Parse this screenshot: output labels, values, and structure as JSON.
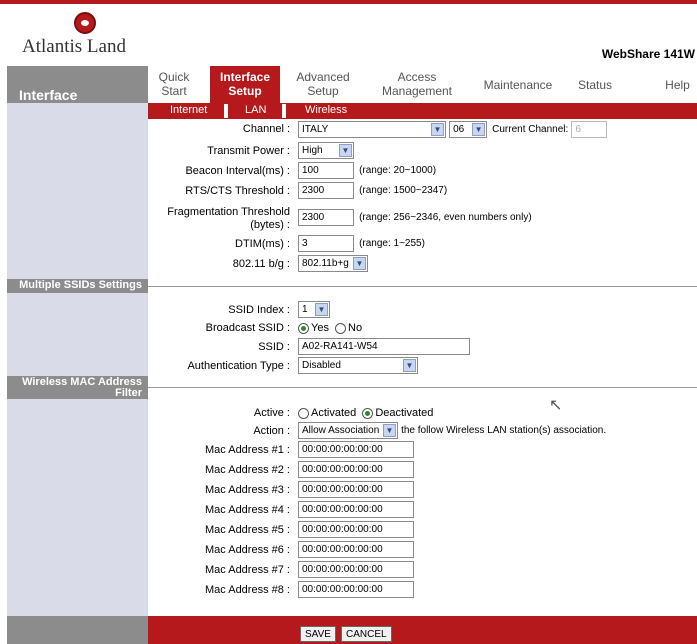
{
  "brand": {
    "logo_text": "Atlantis Land",
    "model": "WebShare 141W"
  },
  "sidebar": {
    "title": "Interface"
  },
  "menu": [
    {
      "label": "Quick\nStart"
    },
    {
      "label": "Interface\nSetup"
    },
    {
      "label": "Advanced\nSetup"
    },
    {
      "label": "Access\nManagement"
    },
    {
      "label": "Maintenance"
    },
    {
      "label": "Status"
    },
    {
      "label": "Help"
    }
  ],
  "submenu": [
    {
      "label": "Internet"
    },
    {
      "label": "LAN"
    },
    {
      "label": "Wireless"
    }
  ],
  "wireless": {
    "channel_label": "Channel :",
    "channel_country": "ITALY",
    "channel_number": "06",
    "current_channel_label": "Current Channel:",
    "current_channel_value": "6",
    "tx_power_label": "Transmit Power :",
    "tx_power_value": "High",
    "beacon_label": "Beacon Interval(ms) :",
    "beacon_value": "100",
    "beacon_hint": "(range: 20~1000)",
    "rts_label": "RTS/CTS Threshold :",
    "rts_value": "2300",
    "rts_hint": "(range: 1500~2347)",
    "frag_label_1": "Fragmentation Threshold",
    "frag_label_2": "(bytes)",
    "frag_value": "2300",
    "frag_hint": "(range: 256~2346, even numbers only)",
    "dtim_label": "DTIM(ms) :",
    "dtim_value": "3",
    "dtim_hint": "(range: 1~255)",
    "mode_label": "802.11 b/g :",
    "mode_value": "802.11b+g"
  },
  "ssid": {
    "section_title": "Multiple SSIDs Settings",
    "index_label": "SSID Index :",
    "index_value": "1",
    "broadcast_label": "Broadcast SSID :",
    "yes_label": "Yes",
    "no_label": "No",
    "ssid_label": "SSID :",
    "ssid_value": "A02-RA141-W54",
    "auth_label": "Authentication Type :",
    "auth_value": "Disabled"
  },
  "mac_filter": {
    "section_title_1": "Wireless MAC Address",
    "section_title_2": "Filter",
    "active_label": "Active :",
    "activated_label": "Activated",
    "deactivated_label": "Deactivated",
    "action_label": "Action :",
    "action_value": "Allow Association",
    "action_suffix": "the follow Wireless LAN station(s) association.",
    "addresses": [
      {
        "label": "Mac Address #1 :",
        "value": "00:00:00:00:00:00"
      },
      {
        "label": "Mac Address #2 :",
        "value": "00:00:00:00:00:00"
      },
      {
        "label": "Mac Address #3 :",
        "value": "00:00:00:00:00:00"
      },
      {
        "label": "Mac Address #4 :",
        "value": "00:00:00:00:00:00"
      },
      {
        "label": "Mac Address #5 :",
        "value": "00:00:00:00:00:00"
      },
      {
        "label": "Mac Address #6 :",
        "value": "00:00:00:00:00:00"
      },
      {
        "label": "Mac Address #7 :",
        "value": "00:00:00:00:00:00"
      },
      {
        "label": "Mac Address #8 :",
        "value": "00:00:00:00:00:00"
      }
    ]
  },
  "buttons": {
    "save": "SAVE",
    "cancel": "CANCEL"
  },
  "colors": {
    "accent_red": "#b5191c",
    "sidebar_gray": "#8c8c8c",
    "sidebar_blue": "#d9dce8"
  }
}
